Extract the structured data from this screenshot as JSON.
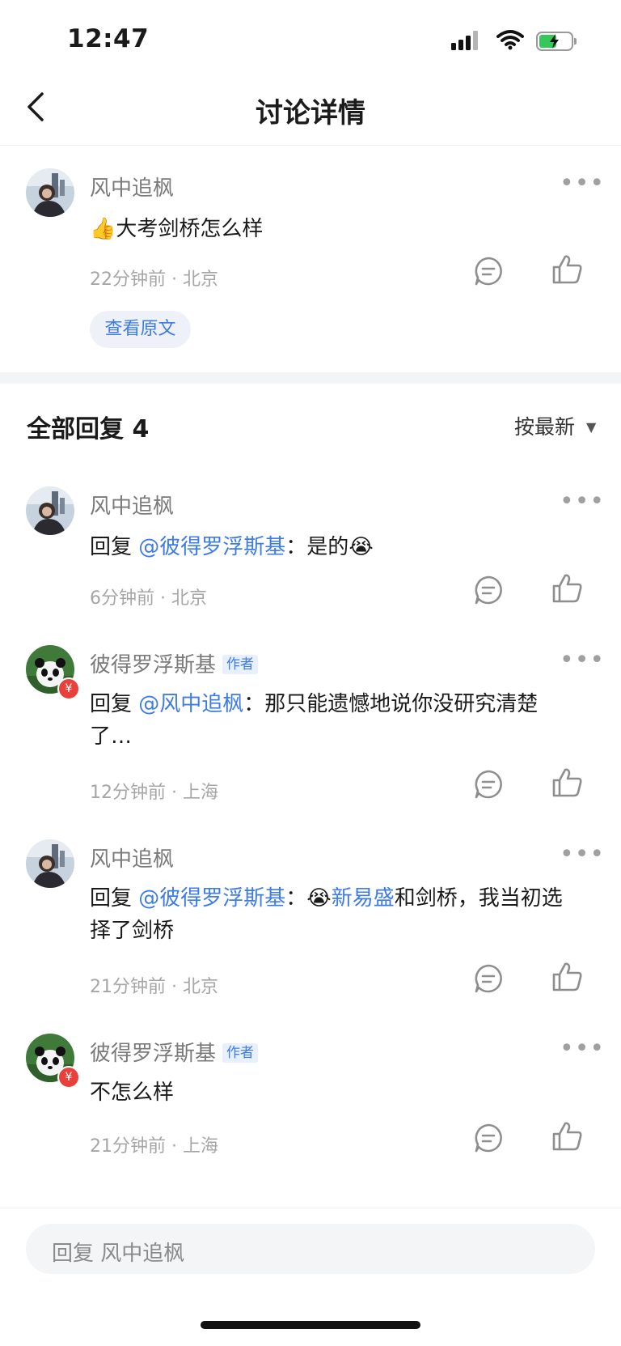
{
  "status_bar": {
    "time": "12:47",
    "battery_level": 0.55
  },
  "nav": {
    "title": "讨论详情"
  },
  "original_post": {
    "username": "风中追枫",
    "text": "大考剑桥怎么样",
    "emoji": "👍",
    "meta": "22分钟前 · 北京",
    "view_original_label": "查看原文"
  },
  "replies_section": {
    "title": "全部回复 4",
    "sort_label": "按最新"
  },
  "replies": [
    {
      "username": "风中追枫",
      "is_author": false,
      "author_badge": "",
      "reply_prefix": "回复 ",
      "mention": "@彼得罗浮斯基",
      "colon": "：",
      "text": "是的",
      "emoji": "😭",
      "meta": "6分钟前 · 北京"
    },
    {
      "username": "彼得罗浮斯基",
      "is_author": true,
      "author_badge": "作者",
      "reply_prefix": "回复 ",
      "mention": "@风中追枫",
      "colon": "：",
      "text_line1": "那只能遗憾地说你没研究清楚",
      "text_line2": "了…",
      "meta": "12分钟前 · 上海"
    },
    {
      "username": "风中追枫",
      "is_author": false,
      "author_badge": "",
      "reply_prefix": "回复 ",
      "mention": "@彼得罗浮斯基",
      "colon": "：",
      "emoji": "😭",
      "link_text": "新易盛",
      "text_line1_rest": "和剑桥，我当初选",
      "text_line2": "择了剑桥",
      "meta": "21分钟前 · 北京"
    },
    {
      "username": "彼得罗浮斯基",
      "is_author": true,
      "author_badge": "作者",
      "text": "不怎么样",
      "meta": "21分钟前 · 上海"
    }
  ],
  "reply_input": {
    "placeholder": "回复 风中追枫"
  },
  "colors": {
    "accent": "#3d7be8",
    "meta_gray": "#a6a6a6",
    "band": "#f3f4f6"
  }
}
